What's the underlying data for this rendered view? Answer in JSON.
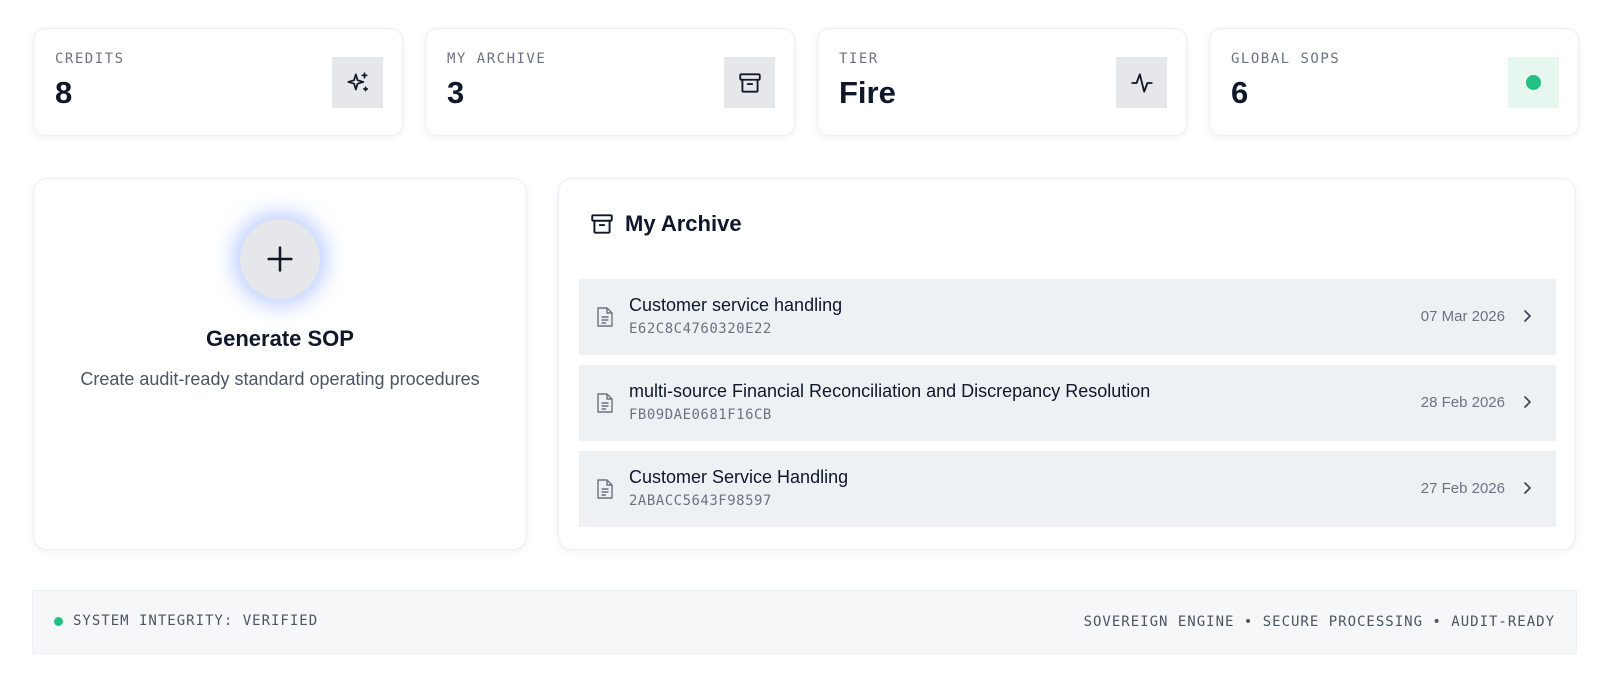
{
  "stats": [
    {
      "label": "CREDITS",
      "value": "8",
      "icon": "sparkles-icon"
    },
    {
      "label": "MY ARCHIVE",
      "value": "3",
      "icon": "archive-box-icon"
    },
    {
      "label": "TIER",
      "value": "Fire",
      "icon": "activity-pulse-icon"
    },
    {
      "label": "GLOBAL SOPS",
      "value": "6",
      "icon": "status-dot-icon",
      "accent": "#22c083"
    }
  ],
  "generate": {
    "title": "Generate SOP",
    "subtitle": "Create audit-ready standard operating procedures",
    "icon": "plus-icon"
  },
  "archive": {
    "title": "My Archive",
    "icon": "archive-box-icon",
    "items": [
      {
        "name": "Customer service handling",
        "code": "E62C8C4760320E22",
        "date": "07 Mar 2026"
      },
      {
        "name": "multi-source Financial Reconciliation and Discrepancy Resolution",
        "code": "FB09DAE0681F16CB",
        "date": "28 Feb 2026"
      },
      {
        "name": "Customer Service Handling",
        "code": "2ABACC5643F98597",
        "date": "27 Feb 2026"
      }
    ]
  },
  "footer": {
    "status": "SYSTEM INTEGRITY: VERIFIED",
    "tagline": "SOVEREIGN ENGINE • SECURE PROCESSING • AUDIT-READY",
    "status_color": "#22c083"
  }
}
